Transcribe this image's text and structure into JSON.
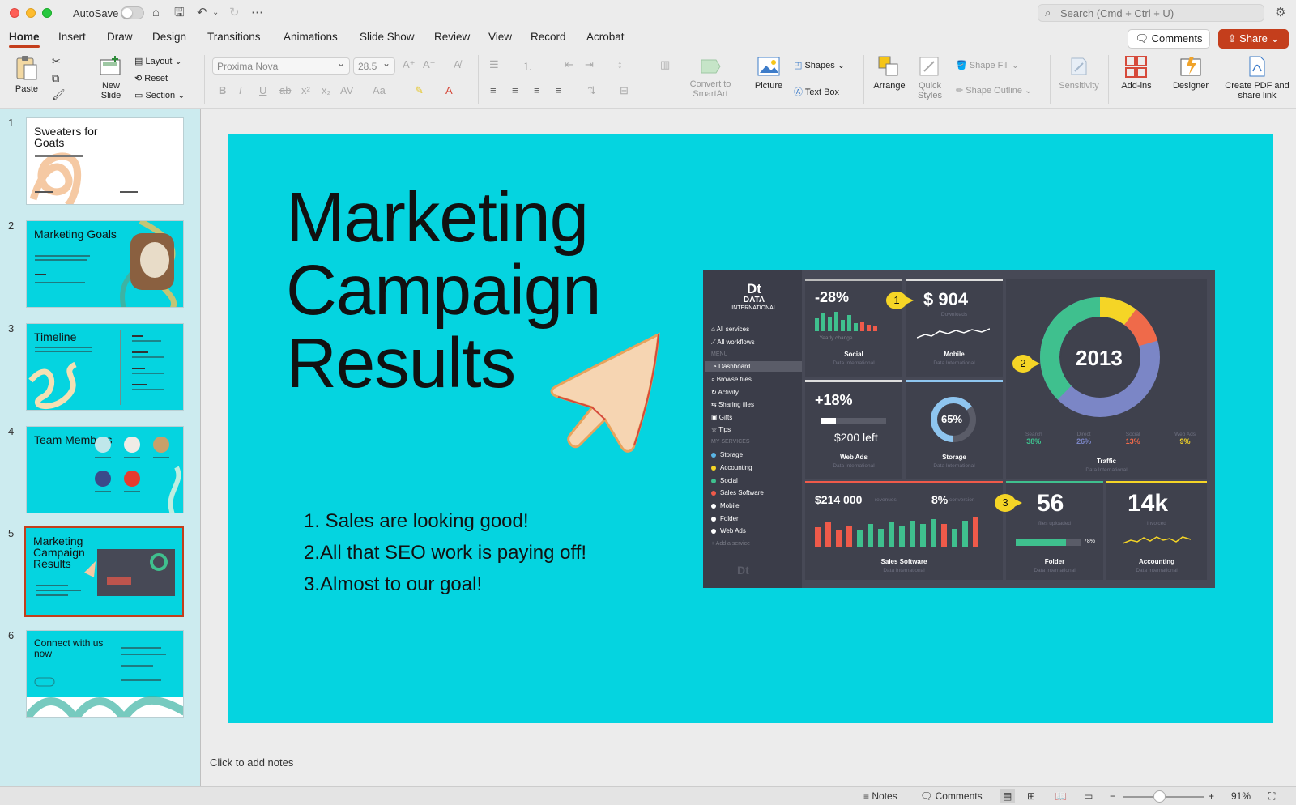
{
  "titlebar": {
    "autosave_label": "AutoSave",
    "search_placeholder": "Search (Cmd + Ctrl + U)"
  },
  "ribbon_tabs": [
    "Home",
    "Insert",
    "Draw",
    "Design",
    "Transitions",
    "Animations",
    "Slide Show",
    "Review",
    "View",
    "Record",
    "Acrobat"
  ],
  "active_tab": "Home",
  "header_buttons": {
    "comments": "Comments",
    "share": "Share"
  },
  "ribbon": {
    "paste": "Paste",
    "new_slide": "New Slide",
    "layout": "Layout",
    "reset": "Reset",
    "section": "Section",
    "font_name": "Proxima Nova",
    "font_size": "28.5",
    "convert_smartart": "Convert to SmartArt",
    "picture": "Picture",
    "shapes": "Shapes",
    "text_box": "Text Box",
    "arrange": "Arrange",
    "quick_styles": "Quick Styles",
    "shape_fill": "Shape Fill",
    "shape_outline": "Shape Outline",
    "sensitivity": "Sensitivity",
    "add_ins": "Add-ins",
    "designer": "Designer",
    "create_pdf": "Create PDF and share link"
  },
  "thumbnails": [
    {
      "num": "1",
      "title": "Sweaters for Goats"
    },
    {
      "num": "2",
      "title": "Marketing Goals"
    },
    {
      "num": "3",
      "title": "Timeline"
    },
    {
      "num": "4",
      "title": "Team Members"
    },
    {
      "num": "5",
      "title": "Marketing Campaign Results"
    },
    {
      "num": "6",
      "title": "Connect with us now"
    }
  ],
  "selected_slide": 5,
  "slide": {
    "title": "Marketing Campaign Results",
    "list": [
      "1. Sales are looking good!",
      "2.All that SEO work is paying off!",
      "3.Almost to our goal!"
    ],
    "background": "#05d4e0"
  },
  "dashboard": {
    "logo_mark": "Dt",
    "logo_line1": "DATA",
    "logo_line2": "INTERNATIONAL",
    "nav_top": [
      "All services",
      "All workflows"
    ],
    "menu_label": "MENU",
    "nav_menu": [
      "Dashboard",
      "Browse files",
      "Activity",
      "Sharing files",
      "Gifts",
      "Tips"
    ],
    "services_label": "MY SERVICES",
    "services": [
      {
        "label": "Storage",
        "color": "#5ab6e6"
      },
      {
        "label": "Accounting",
        "color": "#f5d526"
      },
      {
        "label": "Social",
        "color": "#3fc08e"
      },
      {
        "label": "Sales Software",
        "color": "#ef5a4a"
      },
      {
        "label": "Mobile",
        "color": "#ffffff"
      },
      {
        "label": "Folder",
        "color": "#ffffff"
      },
      {
        "label": "Web Ads",
        "color": "#ffffff"
      }
    ],
    "add_service": "+ Add a service",
    "social": {
      "value": "-28%",
      "note": "Yearly change",
      "label": "Social",
      "sub": "Data International"
    },
    "mobile": {
      "value": "$ 904",
      "note": "Downloads",
      "label": "Mobile",
      "sub": "Data International"
    },
    "web_ads": {
      "value": "+18%",
      "note": "$200 left",
      "label": "Web Ads",
      "sub": "Data International"
    },
    "storage": {
      "value": "65%",
      "label": "Storage",
      "sub": "Data International"
    },
    "traffic": {
      "center": "2013",
      "label": "Traffic",
      "sub": "Data International",
      "legend": [
        {
          "name": "Search",
          "pct": "38%",
          "value": 38,
          "color": "#3fc08e"
        },
        {
          "name": "Direct",
          "pct": "26%",
          "value": 26,
          "color": "#7b86c6"
        },
        {
          "name": "Social",
          "pct": "13%",
          "value": 13,
          "color": "#ef6a4a"
        },
        {
          "name": "Web Ads",
          "pct": "9%",
          "value": 9,
          "color": "#f5d526"
        }
      ]
    },
    "sales": {
      "value": "$214 000",
      "value_note": "revenues",
      "conv": "8%",
      "conv_note": "conversion",
      "label": "Sales Software",
      "sub": "Data International"
    },
    "folder": {
      "value": "56",
      "note": "files uploaded",
      "progress": "78%",
      "label": "Folder",
      "sub": "Data International"
    },
    "accounting": {
      "value": "14k",
      "note": "invoiced",
      "label": "Accounting",
      "sub": "Data International"
    },
    "markers": [
      "1",
      "2",
      "3"
    ]
  },
  "notes_placeholder": "Click to add notes",
  "status": {
    "notes": "Notes",
    "comments": "Comments",
    "zoom": "91%"
  }
}
